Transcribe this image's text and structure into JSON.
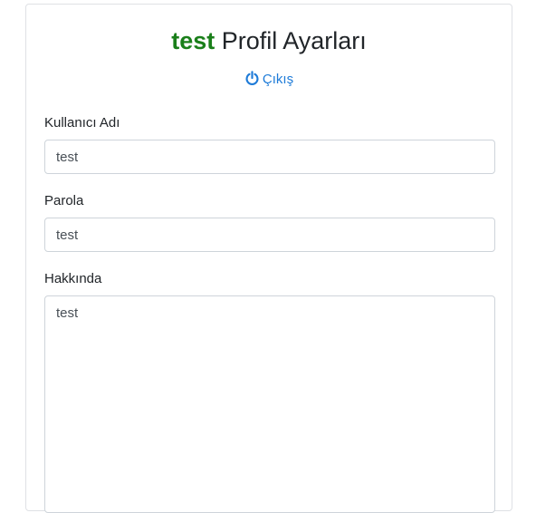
{
  "header": {
    "username": "test",
    "title_suffix": "Profil Ayarları"
  },
  "logout": {
    "label": "Çıkış",
    "icon": "power-icon",
    "color": "#1e7bd8"
  },
  "form": {
    "username_label": "Kullanıcı Adı",
    "username_value": "test",
    "password_label": "Parola",
    "password_value": "test",
    "about_label": "Hakkında",
    "about_value": "test"
  },
  "colors": {
    "username_accent": "#1a7f1a",
    "link": "#1e7bd8"
  }
}
